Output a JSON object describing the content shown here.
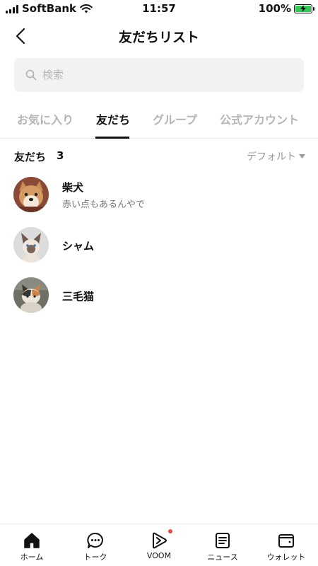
{
  "status_bar": {
    "carrier": "SoftBank",
    "time": "11:57",
    "battery": "100%",
    "battery_level": 1.0
  },
  "header": {
    "title": "友だちリスト",
    "back_icon": "chevron-left-icon"
  },
  "search": {
    "placeholder": "検索",
    "value": ""
  },
  "tabs": [
    {
      "label": "お気に入り"
    },
    {
      "label": "友だち"
    },
    {
      "label": "グループ"
    },
    {
      "label": "公式アカウント"
    }
  ],
  "active_tab": "友だち",
  "section": {
    "title": "友だち",
    "count": "3",
    "sort_label": "デフォルト"
  },
  "friends": [
    {
      "name": "柴犬",
      "status": "赤い点もあるんやで",
      "avatar": "shiba-dog-photo"
    },
    {
      "name": "シャム",
      "status": "",
      "avatar": "siamese-cat-photo"
    },
    {
      "name": "三毛猫",
      "status": "",
      "avatar": "calico-cat-photo"
    }
  ],
  "bottom_nav": [
    {
      "label": "ホーム",
      "icon": "home-icon"
    },
    {
      "label": "トーク",
      "icon": "chat-bubble-icon"
    },
    {
      "label": "VOOM",
      "icon": "play-icon"
    },
    {
      "label": "ニュース",
      "icon": "news-icon"
    },
    {
      "label": "ウォレット",
      "icon": "wallet-icon"
    }
  ],
  "colors": {
    "accent": "#111111",
    "inactive_tab": "#b5b5b5",
    "search_bg": "#f2f2f2",
    "notification_dot": "#e84b4b",
    "battery_fill": "#34c759"
  }
}
